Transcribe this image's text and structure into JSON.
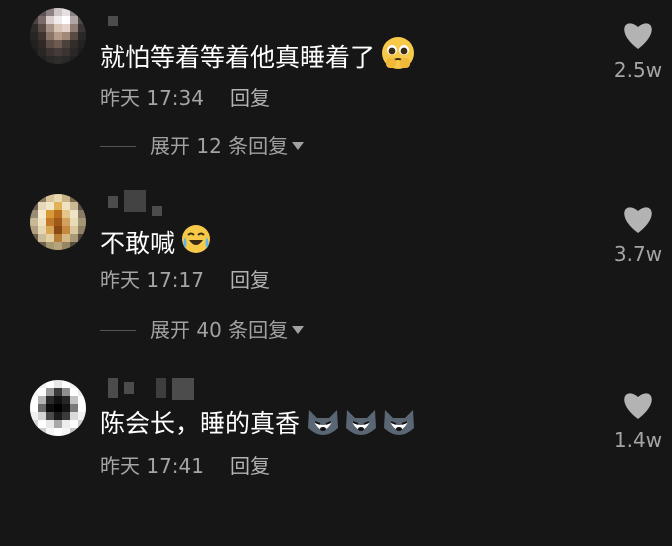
{
  "comments": [
    {
      "text": "就怕等着等着他真睡着了",
      "emoji": "pleading-face",
      "time": "昨天 17:34",
      "reply_label": "回复",
      "expand_label": "展开 12 条回复",
      "likes": "2.5w"
    },
    {
      "text": "不敢喊",
      "emoji": "crying-laughing-face",
      "time": "昨天 17:17",
      "reply_label": "回复",
      "expand_label": "展开 40 条回复",
      "likes": "3.7w"
    },
    {
      "text": "陈会长，睡的真香",
      "emoji": "husky-face",
      "time": "昨天 17:41",
      "reply_label": "回复",
      "likes": "1.4w"
    }
  ],
  "colors": {
    "background": "#161616",
    "text": "#ffffff",
    "muted": "#a5a5a5",
    "heart": "#b3b3b3"
  }
}
